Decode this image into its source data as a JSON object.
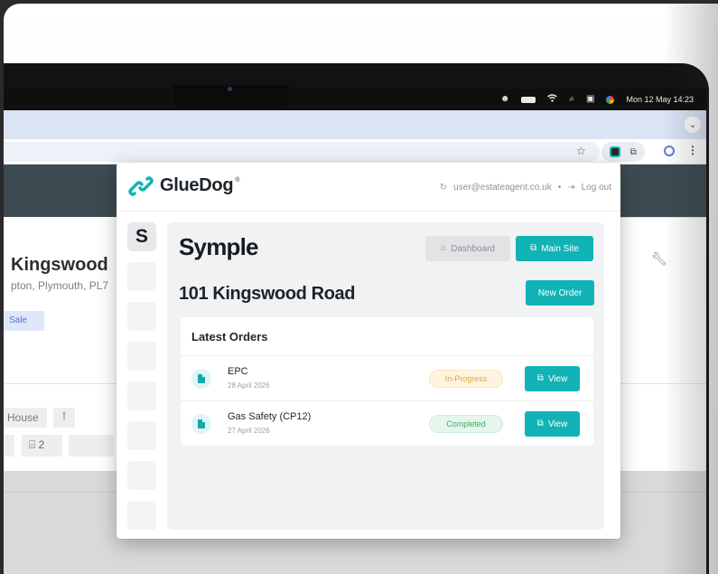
{
  "menubar": {
    "icons": [
      "person-icon",
      "battery-icon",
      "wifi-icon",
      "search-icon",
      "control-center-icon",
      "siri-icon"
    ],
    "datetime": "Mon 12 May 14:23"
  },
  "browser": {
    "tab_chevron": "⌄",
    "star": "☆",
    "more": "⋮"
  },
  "background_page": {
    "title": "Kingswood",
    "subtitle": "pton, Plymouth, PL7",
    "pill": "Sale",
    "chip_house": "House",
    "chip_count": "2"
  },
  "popup": {
    "brand": "GlueDog",
    "brand_mark": "®",
    "user_email": "user@estateagent.co.uk",
    "separator": "•",
    "logout_label": "Log out",
    "rail_letter": "S",
    "app_title": "Symple",
    "dashboard_label": "Dashboard",
    "main_site_label": "Main Site",
    "address": "101 Kingswood Road",
    "new_order_label": "New Order",
    "orders_title": "Latest Orders",
    "view_label": "View",
    "orders": [
      {
        "name": "EPC",
        "date": "28 April 2026",
        "status": "In-Progress"
      },
      {
        "name": "Gas Safety (CP12)",
        "date": "27 April 2026",
        "status": "Completed"
      }
    ]
  },
  "colors": {
    "accent": "#12b3b6",
    "in_progress": "#e2a23c",
    "completed": "#3eab66"
  }
}
